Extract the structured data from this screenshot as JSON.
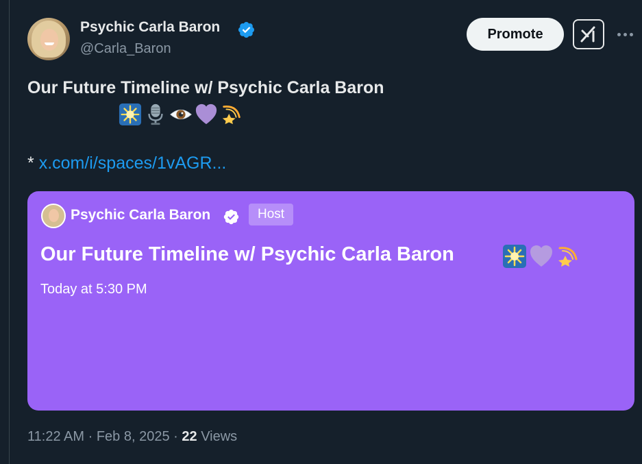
{
  "author": {
    "display_name": "Psychic Carla Baron",
    "handle": "@Carla_Baron",
    "verified": true
  },
  "actions": {
    "promote_label": "Promote",
    "grok_icon": "grok-icon",
    "more_icon": "more-horizontal-icon"
  },
  "tweet": {
    "title": "Our Future Timeline w/ Psychic Carla Baron",
    "emojis": [
      "sparkle-star-emoji",
      "microphone-emoji",
      "eye-emoji",
      "purple-heart-emoji",
      "shooting-star-emoji"
    ],
    "bullet": "*",
    "link_text": "x.com/i/spaces/1vAGR..."
  },
  "space_card": {
    "host_name": "Psychic Carla Baron",
    "host_badge": "Host",
    "title": "Our Future Timeline w/ Psychic Carla Baron",
    "title_emojis": [
      "sparkle-star-emoji",
      "purple-heart-emoji",
      "shooting-star-emoji"
    ],
    "scheduled_time": "Today at 5:30 PM",
    "background_color": "#9a63f7"
  },
  "meta": {
    "time": "11:22 AM",
    "separator": "·",
    "date": "Feb 8, 2025",
    "views_count": "22",
    "views_label": "Views"
  },
  "colors": {
    "background": "#15202b",
    "text_primary": "#e7e9ea",
    "text_secondary": "#8b98a5",
    "link": "#1d9bf0",
    "verified": "#1d9bf0"
  }
}
